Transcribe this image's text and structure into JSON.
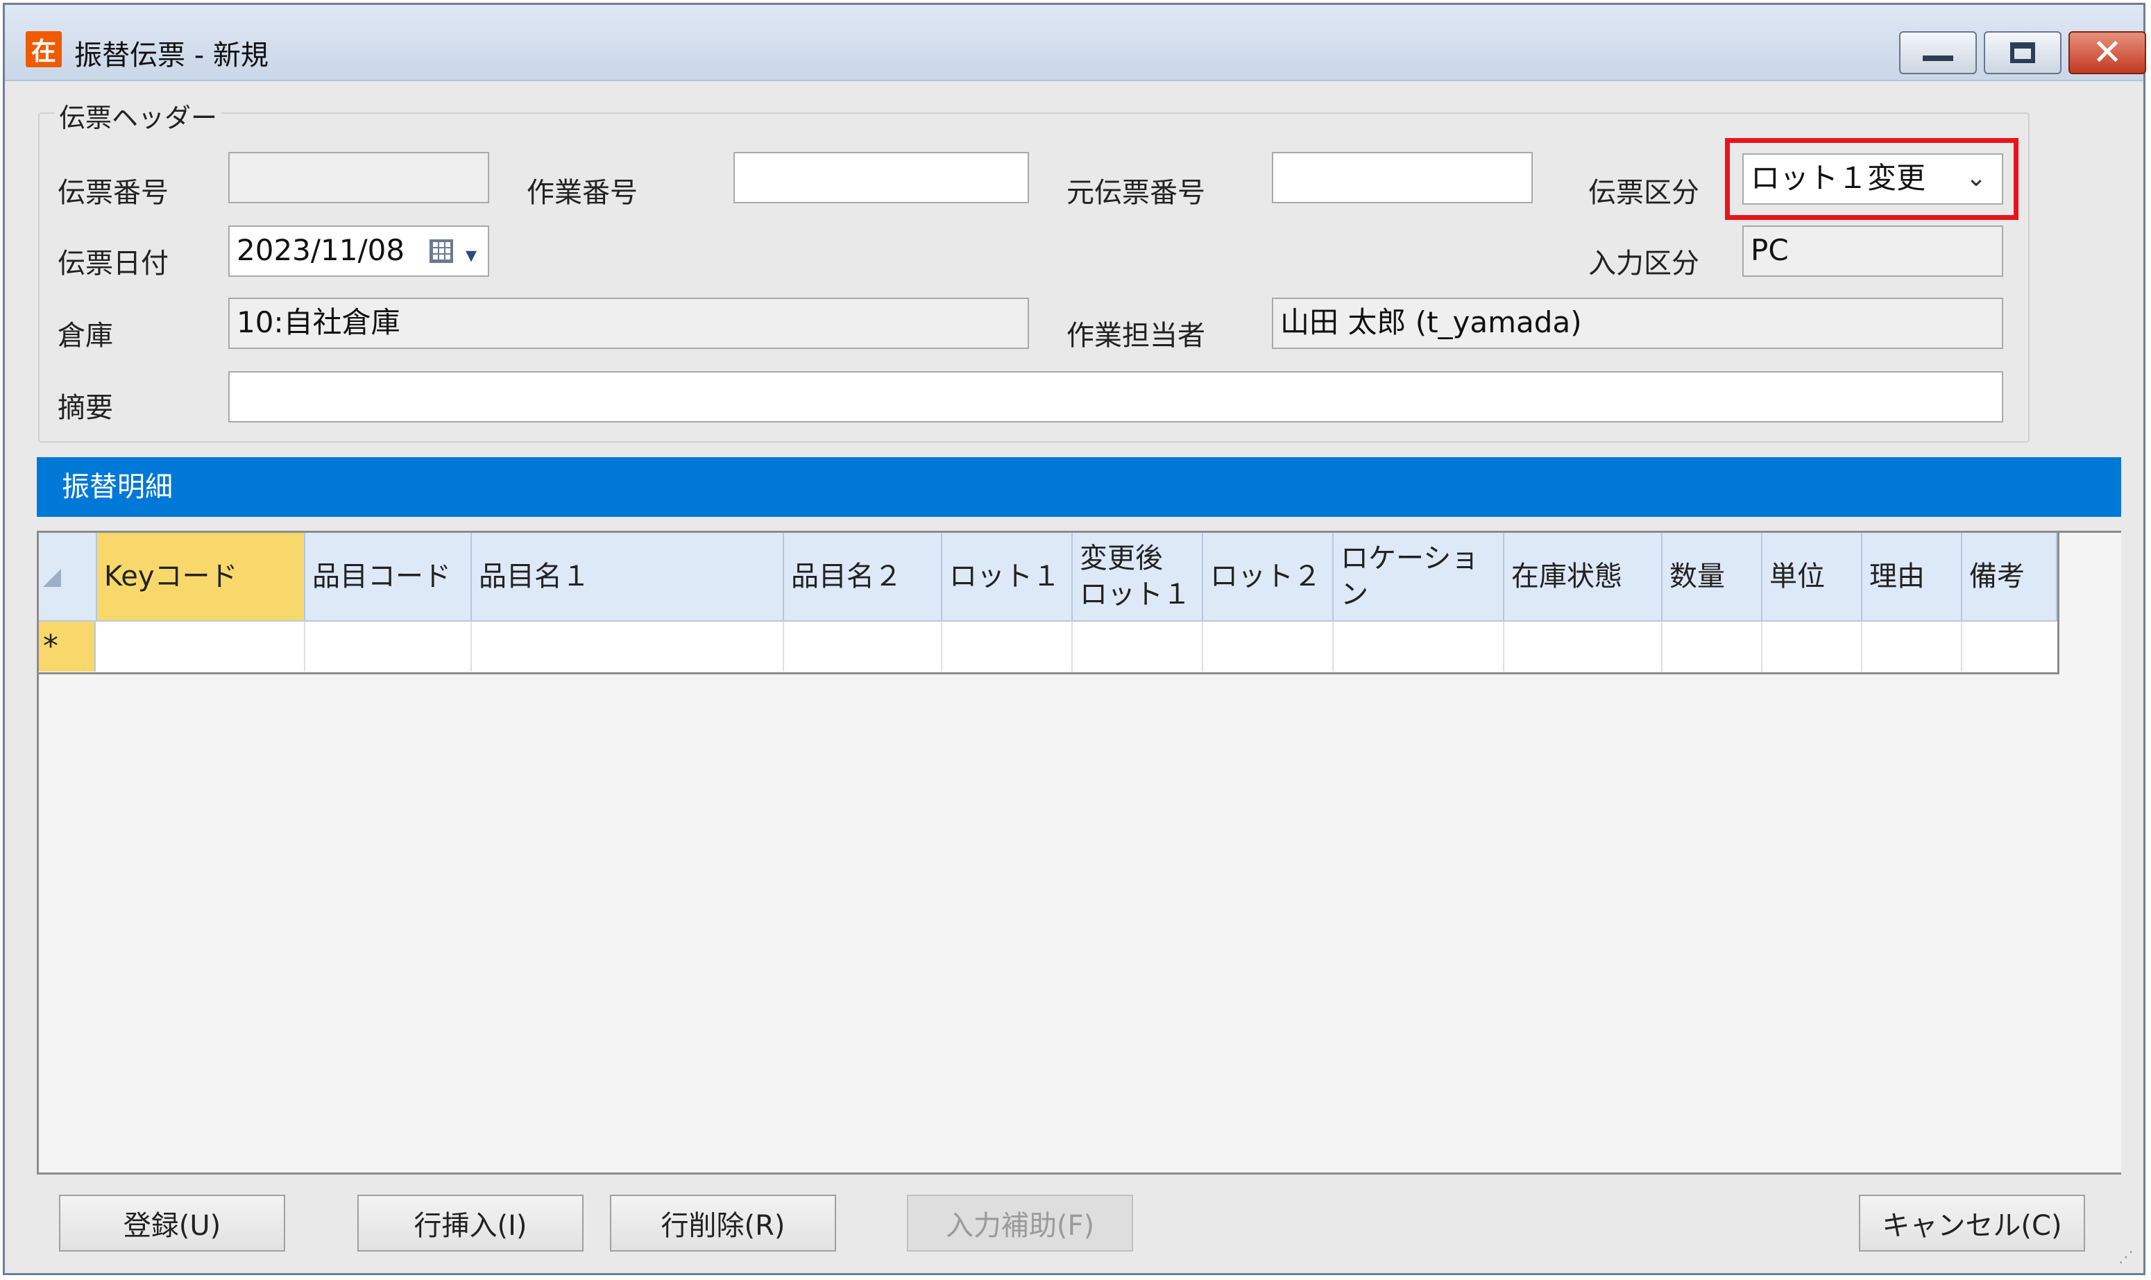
{
  "window": {
    "icon_char": "在",
    "title": "振替伝票 - 新規",
    "controls": {
      "minimize": "minimize-icon",
      "maximize": "maximize-icon",
      "close": "close-icon"
    }
  },
  "header_group": {
    "legend": "伝票ヘッダー",
    "denpyo_no": {
      "label": "伝票番号",
      "value": ""
    },
    "sagyo_no": {
      "label": "作業番号",
      "value": ""
    },
    "moto_denpyo_no": {
      "label": "元伝票番号",
      "value": ""
    },
    "denpyo_kubun": {
      "label": "伝票区分",
      "value": "ロット１変更"
    },
    "denpyo_date": {
      "label": "伝票日付",
      "value": "2023/11/08"
    },
    "input_kubun": {
      "label": "入力区分",
      "value": "PC"
    },
    "warehouse": {
      "label": "倉庫",
      "value": "10:自社倉庫"
    },
    "staff": {
      "label": "作業担当者",
      "value": "山田 太郎 (t_yamada)"
    },
    "memo": {
      "label": "摘要",
      "value": ""
    }
  },
  "detail": {
    "title": "振替明細",
    "columns": [
      "Keyコード",
      "品目コード",
      "品目名１",
      "品目名２",
      "ロット１",
      "変更後\nロット１",
      "ロット２",
      "ロケーション",
      "在庫状態",
      "数量",
      "単位",
      "理由",
      "備考"
    ],
    "new_row_marker": "*"
  },
  "buttons": {
    "register": "登録(U)",
    "insert_row": "行挿入(I)",
    "delete_row": "行削除(R)",
    "input_assist": "入力補助(F)",
    "cancel": "キャンセル(C)"
  },
  "colors": {
    "section_header": "#0078d7",
    "highlight": "#e8141a",
    "active_header": "#f9d86b"
  }
}
